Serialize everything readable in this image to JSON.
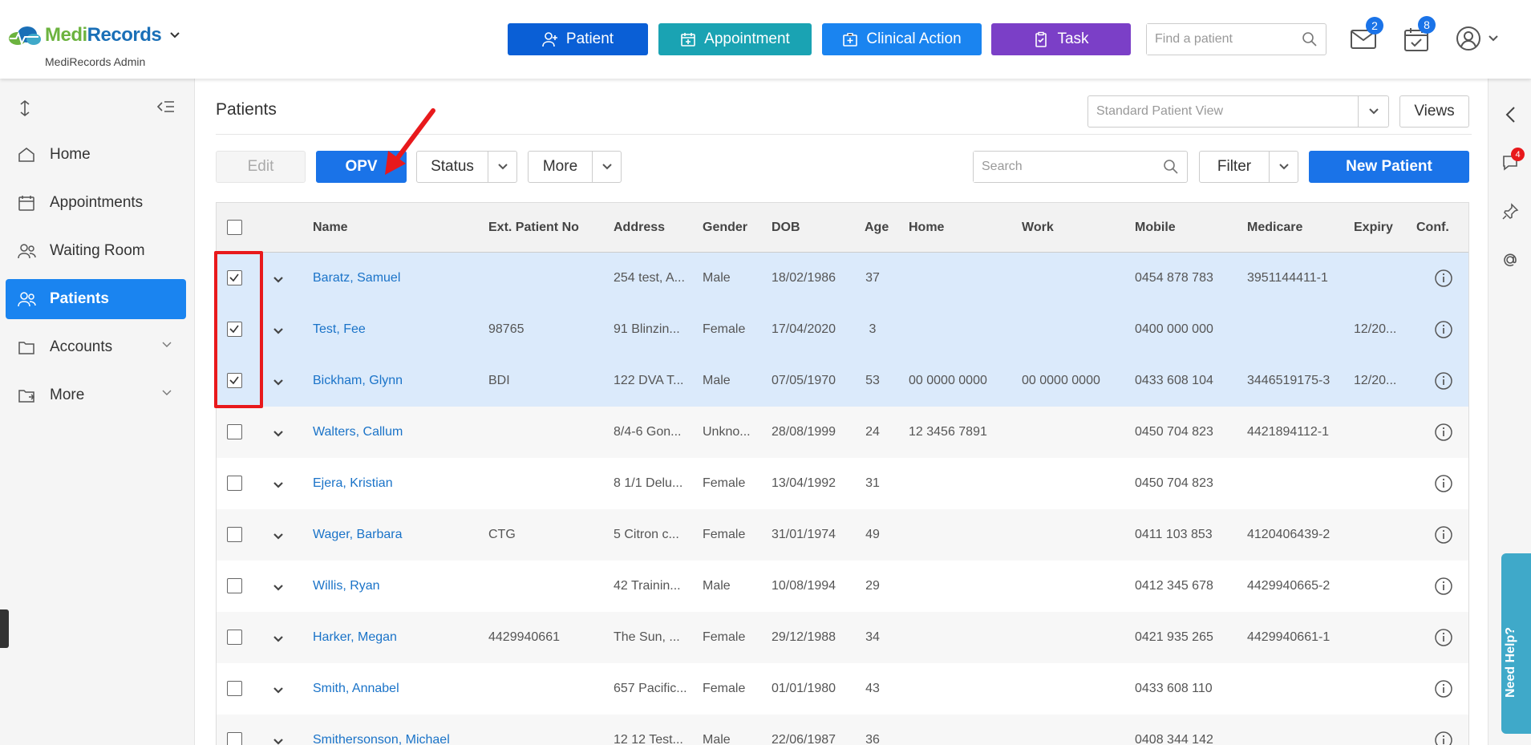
{
  "header": {
    "brand": {
      "part1": "Medi",
      "part2": "Records"
    },
    "org_name": "MediRecords Admin",
    "buttons": [
      {
        "label": "Patient",
        "color": "#0a5fd6",
        "icon": "add-person-icon"
      },
      {
        "label": "Appointment",
        "color": "#1aa3b3",
        "icon": "calendar-plus-icon"
      },
      {
        "label": "Clinical Action",
        "color": "#1a84f0",
        "icon": "medical-case-icon"
      },
      {
        "label": "Task",
        "color": "#7b3fc7",
        "icon": "clipboard-check-icon"
      }
    ],
    "find_placeholder": "Find a patient",
    "mail_badge": "2",
    "tasks_badge": "8"
  },
  "sidebar": {
    "items": [
      {
        "label": "Home",
        "icon": "home-icon"
      },
      {
        "label": "Appointments",
        "icon": "calendar-icon"
      },
      {
        "label": "Waiting Room",
        "icon": "people-icon"
      },
      {
        "label": "Patients",
        "icon": "patients-icon",
        "active": true
      },
      {
        "label": "Accounts",
        "icon": "folder-icon"
      },
      {
        "label": "More",
        "icon": "folder-open-icon"
      }
    ]
  },
  "rail": {
    "chat_badge": "4",
    "help_label": "Need Help?"
  },
  "main": {
    "title": "Patients",
    "view_select": "Standard Patient View",
    "views_label": "Views",
    "toolbar": {
      "edit": "Edit",
      "opv": "OPV",
      "status": "Status",
      "more": "More",
      "search_placeholder": "Search",
      "filter": "Filter",
      "new_patient": "New Patient"
    }
  },
  "table": {
    "columns": [
      "Name",
      "Ext. Patient No",
      "Address",
      "Gender",
      "DOB",
      "Age",
      "Home",
      "Work",
      "Mobile",
      "Medicare",
      "Expiry",
      "Conf."
    ],
    "rows": [
      {
        "name": "Baratz, Samuel",
        "ext": "",
        "address": "254 test, A...",
        "gender": "Male",
        "dob": "18/02/1986",
        "age": "37",
        "home": "",
        "work": "",
        "mobile": "0454 878 783",
        "medicare": "3951144411-1",
        "expiry": "",
        "checked": true
      },
      {
        "name": "Test, Fee",
        "ext": "98765",
        "address": "91 Blinzin...",
        "gender": "Female",
        "dob": "17/04/2020",
        "age": "3",
        "home": "",
        "work": "",
        "mobile": "0400 000 000",
        "medicare": "",
        "expiry": "12/20...",
        "checked": true
      },
      {
        "name": "Bickham, Glynn",
        "ext": "BDI",
        "address": "122 DVA T...",
        "gender": "Male",
        "dob": "07/05/1970",
        "age": "53",
        "home": "00 0000 0000",
        "work": "00 0000 0000",
        "mobile": "0433 608 104",
        "medicare": "3446519175-3",
        "expiry": "12/20...",
        "checked": true
      },
      {
        "name": "Walters, Callum",
        "ext": "",
        "address": "8/4-6 Gon...",
        "gender": "Unkno...",
        "dob": "28/08/1999",
        "age": "24",
        "home": "12 3456 7891",
        "work": "",
        "mobile": "0450 704 823",
        "medicare": "4421894112-1",
        "expiry": "",
        "checked": false
      },
      {
        "name": "Ejera, Kristian",
        "ext": "",
        "address": "8 1/1 Delu...",
        "gender": "Female",
        "dob": "13/04/1992",
        "age": "31",
        "home": "",
        "work": "",
        "mobile": "0450 704 823",
        "medicare": "",
        "expiry": "",
        "checked": false
      },
      {
        "name": "Wager, Barbara",
        "ext": "CTG",
        "address": "5 Citron c...",
        "gender": "Female",
        "dob": "31/01/1974",
        "age": "49",
        "home": "",
        "work": "",
        "mobile": "0411 103 853",
        "medicare": "4120406439-2",
        "expiry": "",
        "checked": false
      },
      {
        "name": "Willis, Ryan",
        "ext": "",
        "address": "42 Trainin...",
        "gender": "Male",
        "dob": "10/08/1994",
        "age": "29",
        "home": "",
        "work": "",
        "mobile": "0412 345 678",
        "medicare": "4429940665-2",
        "expiry": "",
        "checked": false
      },
      {
        "name": "Harker, Megan",
        "ext": "4429940661",
        "address": "The Sun, ...",
        "gender": "Female",
        "dob": "29/12/1988",
        "age": "34",
        "home": "",
        "work": "",
        "mobile": "0421 935 265",
        "medicare": "4429940661-1",
        "expiry": "",
        "checked": false
      },
      {
        "name": "Smith, Annabel",
        "ext": "",
        "address": "657 Pacific...",
        "gender": "Female",
        "dob": "01/01/1980",
        "age": "43",
        "home": "",
        "work": "",
        "mobile": "0433 608 110",
        "medicare": "",
        "expiry": "",
        "checked": false
      },
      {
        "name": "Smithersonson, Michael",
        "ext": "",
        "address": "12 12 Test...",
        "gender": "Male",
        "dob": "22/06/1987",
        "age": "36",
        "home": "",
        "work": "",
        "mobile": "0408 344 142",
        "medicare": "",
        "expiry": "",
        "checked": false
      }
    ]
  }
}
